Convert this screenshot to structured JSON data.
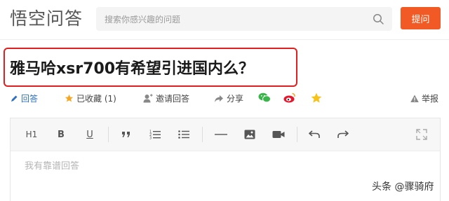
{
  "header": {
    "logo_text": "悟空问答",
    "search_placeholder": "搜索你感兴趣的问题",
    "ask_label": "提问",
    "accent_color": "#f15a24"
  },
  "question": {
    "title": "雅马哈xsr700有希望引进国内么？",
    "highlight_color": "#e02020"
  },
  "actions": {
    "answer": "回答",
    "collected": "已收藏 (1)",
    "invite": "邀请回答",
    "share": "分享",
    "report": "举报",
    "icons": [
      "pencil-icon",
      "star-icon",
      "invite-user-icon",
      "share-arrow-icon",
      "wechat-icon",
      "weibo-icon",
      "favorite-star-icon",
      "warning-icon"
    ]
  },
  "editor": {
    "placeholder": "我有靠谱回答",
    "heading_label": "H1",
    "bold_label": "B",
    "underline_label": "U"
  },
  "watermark": "头条 @骤骑府"
}
